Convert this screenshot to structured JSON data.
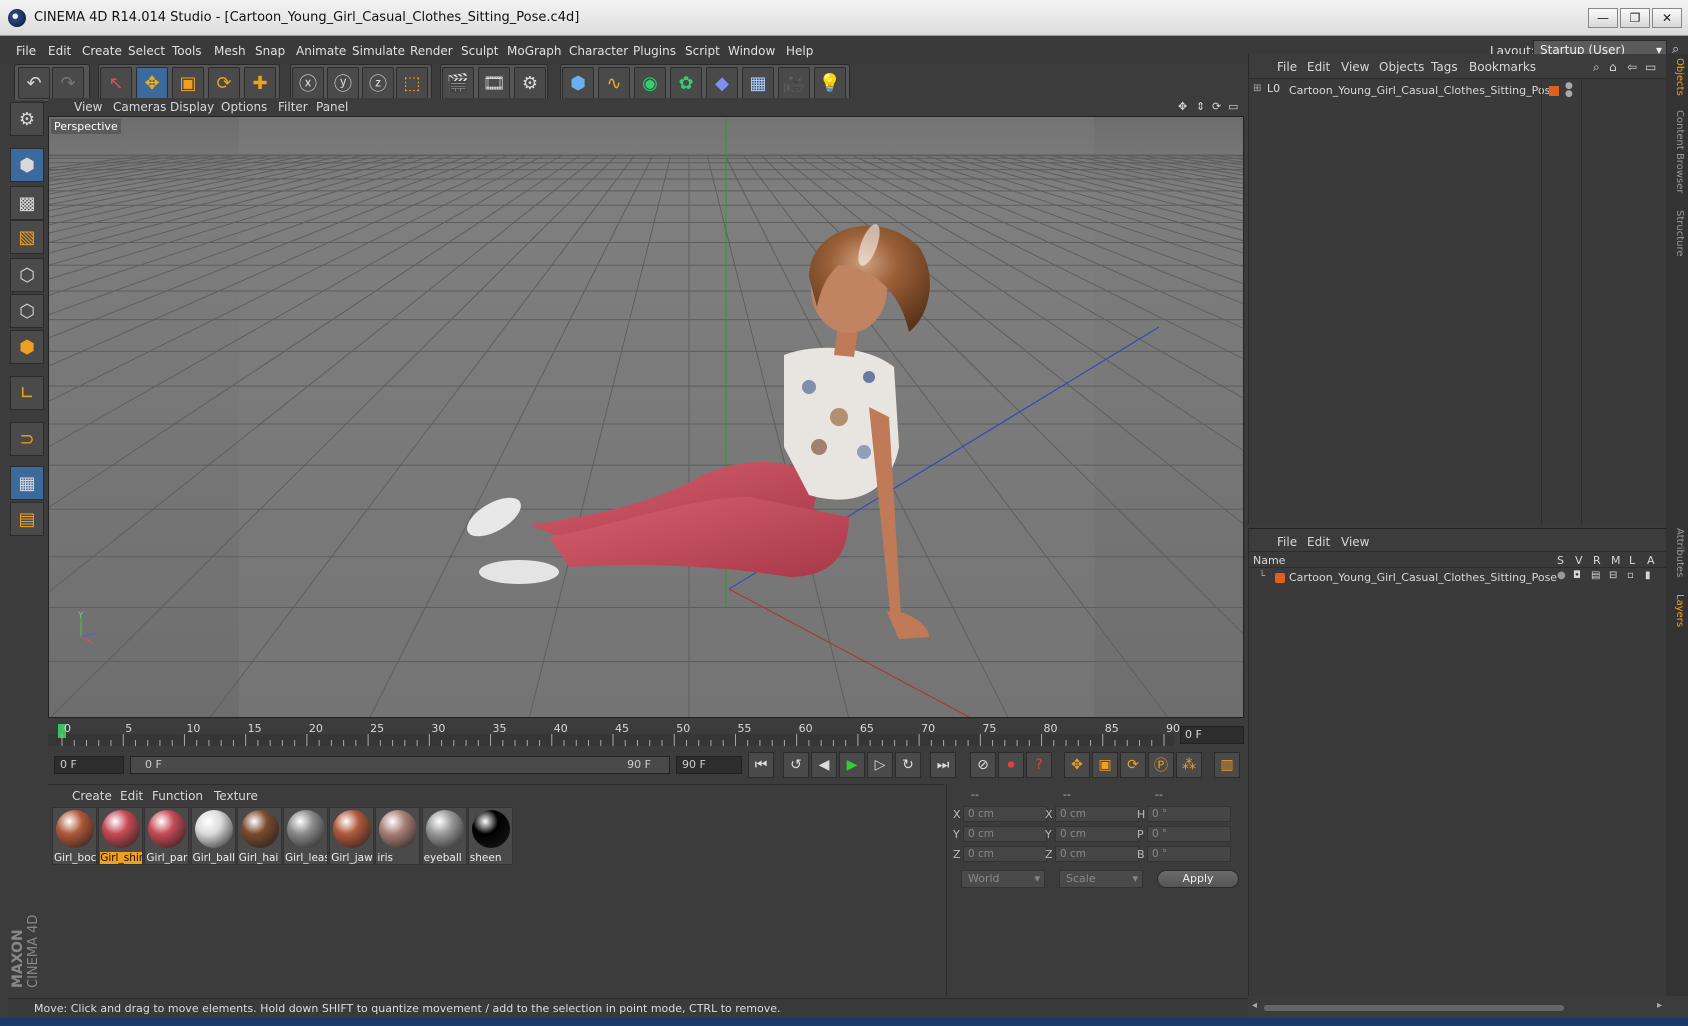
{
  "window": {
    "title": "CINEMA 4D R14.014 Studio - [Cartoon_Young_Girl_Casual_Clothes_Sitting_Pose.c4d]",
    "minimize": "—",
    "restore": "❐",
    "close": "✕"
  },
  "menubar": {
    "items": [
      "File",
      "Edit",
      "Create",
      "Select",
      "Tools",
      "Mesh",
      "Snap",
      "Animate",
      "Simulate",
      "Render",
      "Sculpt",
      "MoGraph",
      "Character",
      "Plugins",
      "Script",
      "Window",
      "Help"
    ],
    "layout_label": "Layout:",
    "layout_value": "Startup (User)"
  },
  "viewport": {
    "menus": [
      "View",
      "Cameras",
      "Display",
      "Options",
      "Filter",
      "Panel"
    ],
    "label": "Perspective",
    "axis_y": "Y"
  },
  "timeline": {
    "ticks": [
      "0",
      "5",
      "10",
      "15",
      "20",
      "25",
      "30",
      "35",
      "40",
      "45",
      "50",
      "55",
      "60",
      "65",
      "70",
      "75",
      "80",
      "85",
      "90"
    ],
    "current_frame": "0 F",
    "start_field": "0 F",
    "range_start": "0 F",
    "range_end": "90 F",
    "end_field": "90 F"
  },
  "materials": {
    "menus": [
      "Create",
      "Edit",
      "Function",
      "Texture"
    ],
    "items": [
      {
        "label": "Girl_boc",
        "color": "#b0583a"
      },
      {
        "label": "Girl_shir",
        "color": "#c64a55"
      },
      {
        "label": "Girl_par",
        "color": "#c64a55"
      },
      {
        "label": "Girl_ball",
        "color": "#dcdcdc"
      },
      {
        "label": "Girl_hai",
        "color": "#7a4a2e"
      },
      {
        "label": "Girl_leas",
        "color": "#8a8a8a"
      },
      {
        "label": "Girl_jaw",
        "color": "#b0583a"
      },
      {
        "label": "iris",
        "color": "#a88078"
      },
      {
        "label": "eyeball",
        "color": "#999999"
      },
      {
        "label": "sheen",
        "color": "#000000"
      }
    ],
    "selected_index": 1
  },
  "coordinates": {
    "headers": [
      "--",
      "--",
      "--"
    ],
    "rows": [
      {
        "a": "X",
        "av": "0 cm",
        "b": "X",
        "bv": "0 cm",
        "c": "H",
        "cv": "0 °"
      },
      {
        "a": "Y",
        "av": "0 cm",
        "b": "Y",
        "bv": "0 cm",
        "c": "P",
        "cv": "0 °"
      },
      {
        "a": "Z",
        "av": "0 cm",
        "b": "Z",
        "bv": "0 cm",
        "c": "B",
        "cv": "0 °"
      }
    ],
    "space_dropdown": "World",
    "mode_dropdown": "Scale",
    "apply": "Apply"
  },
  "objects": {
    "menus": [
      "File",
      "Edit",
      "View",
      "Objects",
      "Tags",
      "Bookmarks"
    ],
    "root": "Cartoon_Young_Girl_Casual_Clothes_Sitting_Pose"
  },
  "layers": {
    "menus": [
      "File",
      "Edit",
      "View"
    ],
    "columns": [
      "Name",
      "S",
      "V",
      "R",
      "M",
      "L",
      "A"
    ],
    "row": "Cartoon_Young_Girl_Casual_Clothes_Sitting_Pose"
  },
  "right_tabs": [
    "Objects",
    "Content Browser",
    "Structure",
    "Attributes",
    "Layers"
  ],
  "status": "Move: Click and drag to move elements. Hold down SHIFT to quantize movement / add to the selection in point mode, CTRL to remove.",
  "logo": {
    "line1": "MAXON",
    "line2": "CINEMA 4D"
  },
  "colors": {
    "accent": "#3d6a9c",
    "selection": "#f0a020",
    "layer_dot": "#e06020"
  }
}
